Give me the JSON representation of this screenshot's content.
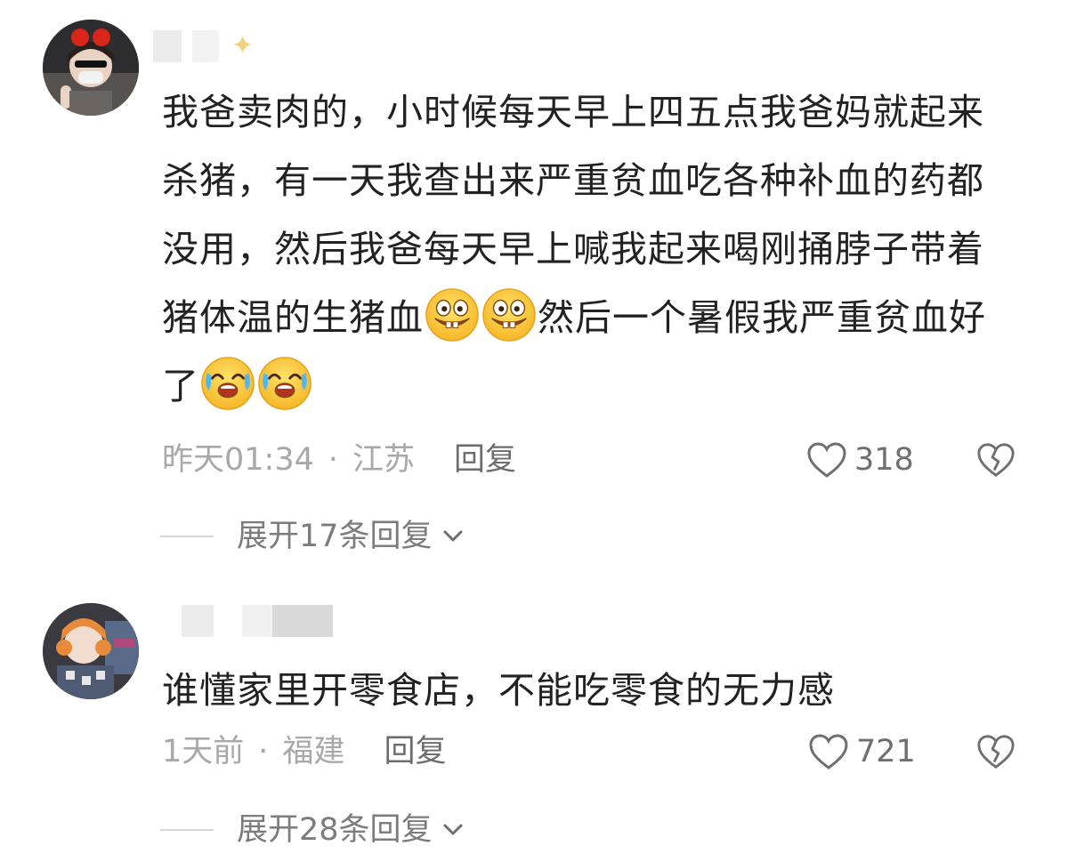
{
  "comments": [
    {
      "text_before": "我爸卖肉的，小时候每天早上四五点我爸妈就起来杀猪，有一天我查出来严重贫血吃各种补血的药都没用，然后我爸每天早上喊我起来喝刚捅脖子带着猪体温的生猪血",
      "text_middle": "然后一个暑假我严重贫血好了",
      "emoji_1": "grinning-teeth-emoji",
      "emoji_2": "crying-laughing-emoji",
      "time": "昨天01:34",
      "separator": "·",
      "location": "江苏",
      "reply_label": "回复",
      "likes": "318",
      "expand_label": "展开17条回复"
    },
    {
      "text_before": "谁懂家里开零食店，不能吃零食的无力感",
      "time": "1天前",
      "separator": "·",
      "location": "福建",
      "reply_label": "回复",
      "likes": "721",
      "expand_label": "展开28条回复"
    }
  ],
  "colors": {
    "text": "#222222",
    "meta": "#a8a8a8",
    "reply": "#6d6d6d",
    "icon": "#6f6f6f"
  }
}
